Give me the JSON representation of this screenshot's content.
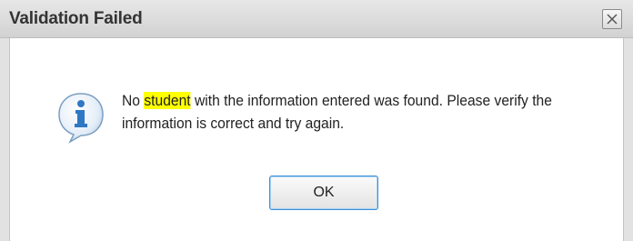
{
  "dialog": {
    "title": "Validation Failed",
    "close_icon": "close-icon",
    "message_icon": "info-icon",
    "message_prefix": "No ",
    "message_highlight": "student",
    "message_suffix": " with the information entered was found. Please verify the information is correct and try again.",
    "ok_label": "OK"
  },
  "colors": {
    "highlight": "#ffff00",
    "button_focus_border": "#3d8fd6",
    "icon_blue": "#2f78c4"
  }
}
